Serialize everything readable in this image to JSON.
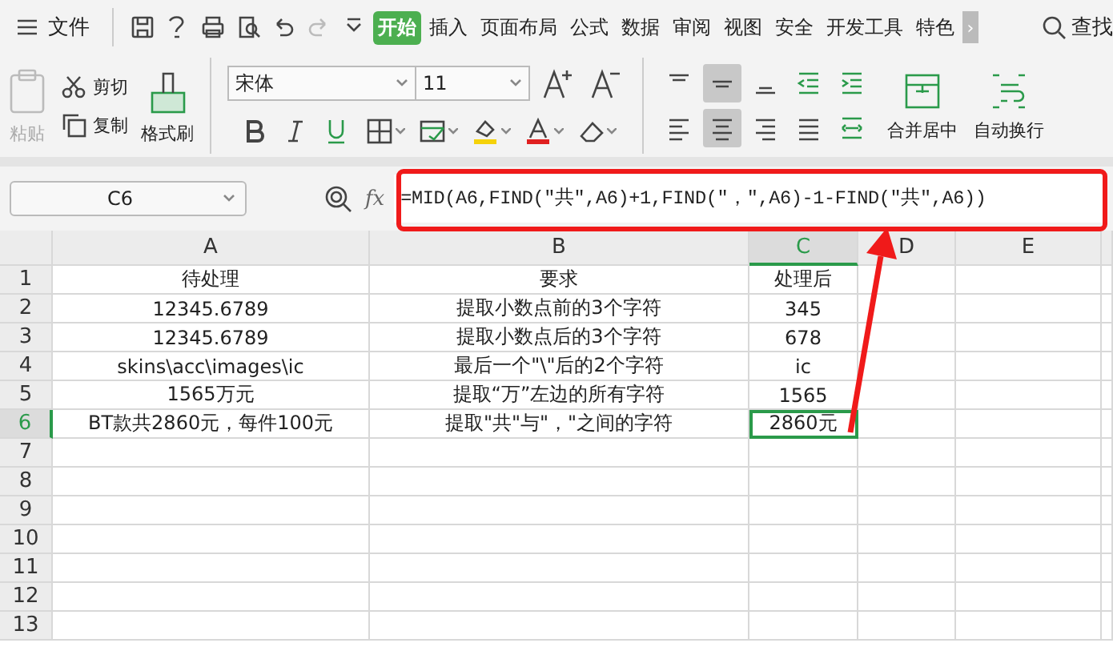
{
  "menu": {
    "file": "文件",
    "tabs": [
      {
        "label": "开始",
        "selected": true
      },
      {
        "label": "插入",
        "selected": false
      },
      {
        "label": "页面布局",
        "selected": false
      },
      {
        "label": "公式",
        "selected": false
      },
      {
        "label": "数据",
        "selected": false
      },
      {
        "label": "审阅",
        "selected": false
      },
      {
        "label": "视图",
        "selected": false
      },
      {
        "label": "安全",
        "selected": false
      },
      {
        "label": "开发工具",
        "selected": false
      },
      {
        "label": "特色",
        "selected": false
      }
    ],
    "more": "›",
    "search": "查找"
  },
  "ribbon": {
    "paste": {
      "label": "粘贴",
      "disabled": true
    },
    "cut": "剪切",
    "copy": "复制",
    "format_painter": "格式刷",
    "font": "宋体",
    "size": "11",
    "merge": "合并居中",
    "wrap": "自动换行",
    "align": [
      {
        "kind": "top",
        "selected": false
      },
      {
        "kind": "middle",
        "selected": true
      },
      {
        "kind": "bottom",
        "selected": false
      },
      {
        "kind": "outdent",
        "selected": false
      },
      {
        "kind": "indent",
        "selected": false
      },
      {
        "kind": "left",
        "selected": false
      },
      {
        "kind": "center",
        "selected": true
      },
      {
        "kind": "right",
        "selected": false
      },
      {
        "kind": "justify",
        "selected": false
      },
      {
        "kind": "distribute",
        "selected": false
      }
    ]
  },
  "formula_bar": {
    "name_box": "C6",
    "fx": "fx",
    "formula": "=MID(A6,FIND(\"共\",A6)+1,FIND(\"，\",A6)-1-FIND(\"共\",A6))"
  },
  "sheet": {
    "columns": [
      {
        "label": "A",
        "selected": false
      },
      {
        "label": "B",
        "selected": false
      },
      {
        "label": "C",
        "selected": true
      },
      {
        "label": "D",
        "selected": false
      },
      {
        "label": "E",
        "selected": false
      }
    ],
    "rows": [
      {
        "label": "1",
        "selected": false,
        "cells": [
          {
            "text": "待处理",
            "selected": false
          },
          {
            "text": "要求",
            "selected": false
          },
          {
            "text": "处理后",
            "selected": false
          }
        ]
      },
      {
        "label": "2",
        "selected": false,
        "cells": [
          {
            "text": "12345.6789",
            "selected": false
          },
          {
            "text": "提取小数点前的3个字符",
            "selected": false
          },
          {
            "text": "345",
            "selected": false
          }
        ]
      },
      {
        "label": "3",
        "selected": false,
        "cells": [
          {
            "text": "12345.6789",
            "selected": false
          },
          {
            "text": "提取小数点后的3个字符",
            "selected": false
          },
          {
            "text": "678",
            "selected": false
          }
        ]
      },
      {
        "label": "4",
        "selected": false,
        "cells": [
          {
            "text": "skins\\acc\\images\\ic",
            "selected": false
          },
          {
            "text": "最后一个\"\\\"后的2个字符",
            "selected": false
          },
          {
            "text": "ic",
            "selected": false
          }
        ]
      },
      {
        "label": "5",
        "selected": false,
        "cells": [
          {
            "text": "1565万元",
            "selected": false
          },
          {
            "text": "提取“万”左边的所有字符",
            "selected": false
          },
          {
            "text": "1565",
            "selected": false
          }
        ]
      },
      {
        "label": "6",
        "selected": true,
        "cells": [
          {
            "text": "BT款共2860元，每件100元",
            "selected": false
          },
          {
            "text": "提取\"共\"与\"，\"之间的字符",
            "selected": false
          },
          {
            "text": "2860元",
            "selected": true
          }
        ]
      },
      {
        "label": "7",
        "selected": false,
        "cells": []
      },
      {
        "label": "8",
        "selected": false,
        "cells": []
      },
      {
        "label": "9",
        "selected": false,
        "cells": []
      },
      {
        "label": "10",
        "selected": false,
        "cells": []
      },
      {
        "label": "11",
        "selected": false,
        "cells": []
      },
      {
        "label": "12",
        "selected": false,
        "cells": []
      },
      {
        "label": "13",
        "selected": false,
        "cells": []
      }
    ]
  }
}
